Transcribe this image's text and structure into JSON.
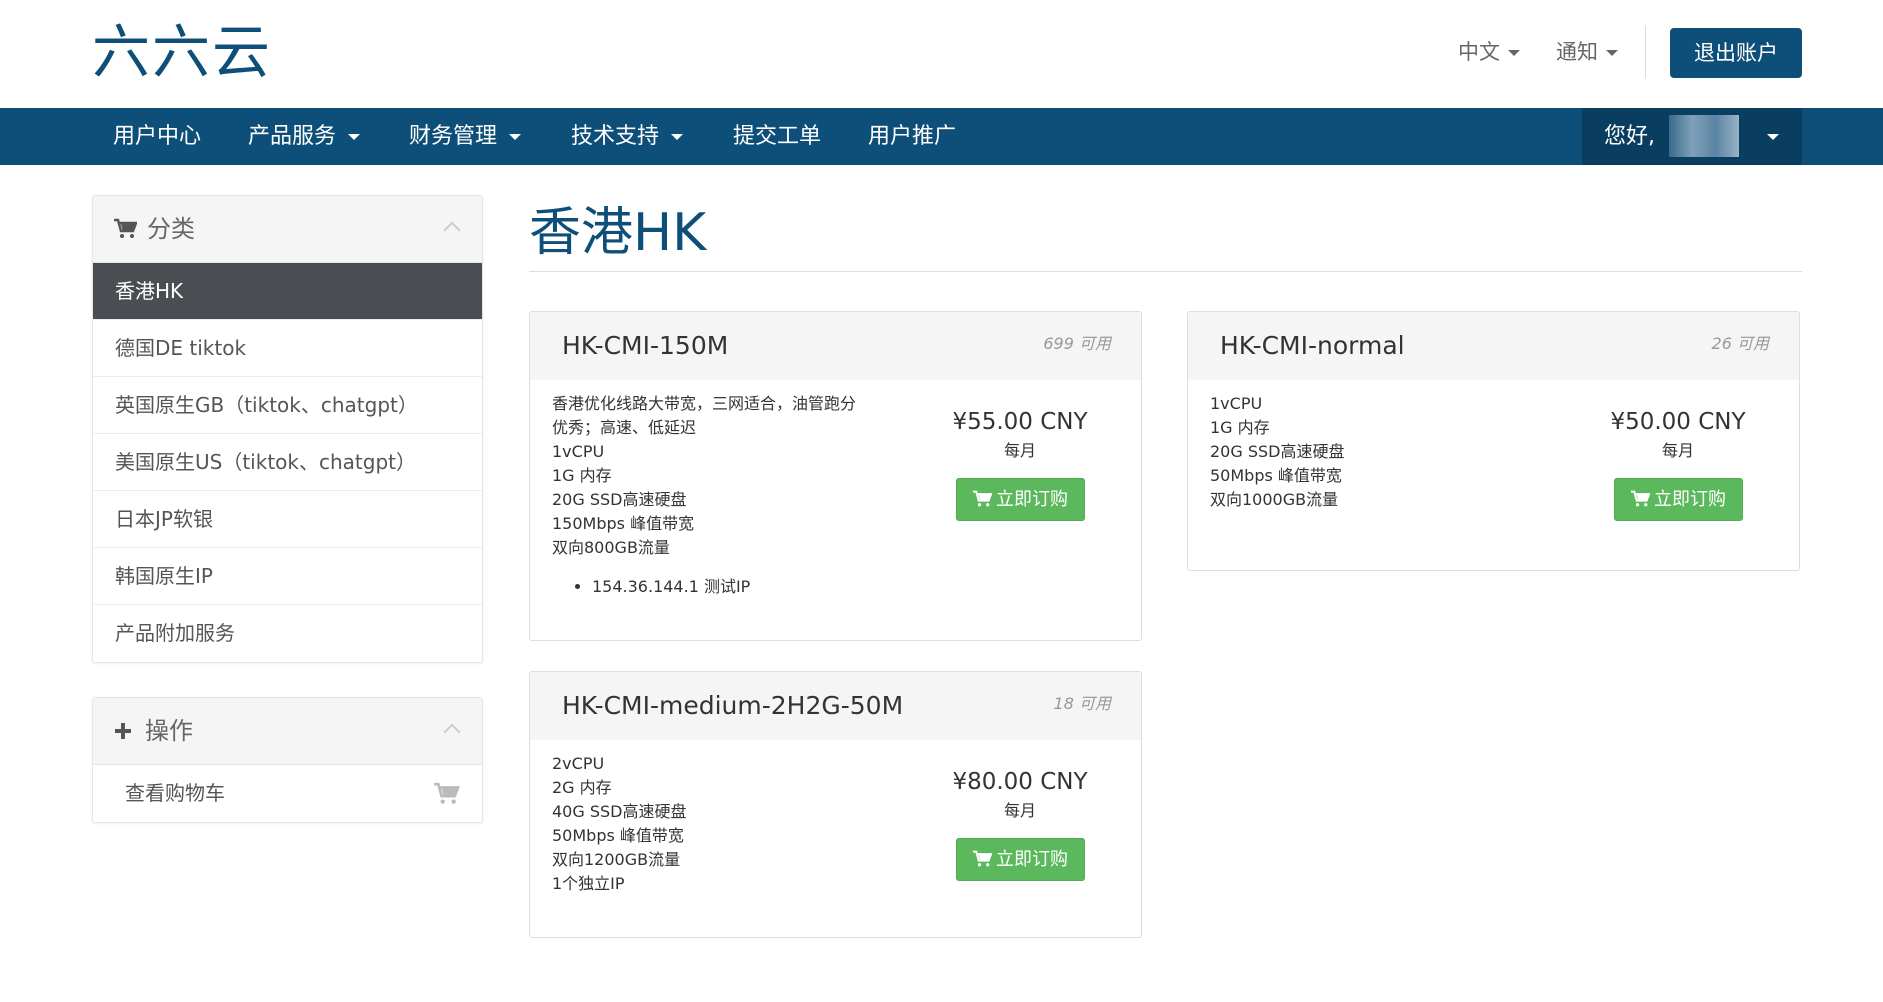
{
  "header": {
    "logo_text": "六六云",
    "language_label": "中文",
    "notifications_label": "通知",
    "logout_label": "退出账户"
  },
  "nav": {
    "items": [
      {
        "label": "用户中心",
        "dropdown": false
      },
      {
        "label": "产品服务",
        "dropdown": true
      },
      {
        "label": "财务管理",
        "dropdown": true
      },
      {
        "label": "技术支持",
        "dropdown": true
      },
      {
        "label": "提交工单",
        "dropdown": false
      },
      {
        "label": "用户推广",
        "dropdown": false
      }
    ],
    "greeting": "您好,"
  },
  "sidebar": {
    "categories_title": "分类",
    "categories": [
      {
        "label": "香港HK",
        "active": true
      },
      {
        "label": "德国DE tiktok",
        "active": false
      },
      {
        "label": "英国原生GB（tiktok、chatgpt）",
        "active": false
      },
      {
        "label": "美国原生US（tiktok、chatgpt）",
        "active": false
      },
      {
        "label": "日本JP软银",
        "active": false
      },
      {
        "label": "韩国原生IP",
        "active": false
      },
      {
        "label": "产品附加服务",
        "active": false
      }
    ],
    "actions_title": "操作",
    "actions": [
      {
        "label": "查看购物车"
      }
    ]
  },
  "main": {
    "page_title": "香港HK",
    "products": [
      {
        "name": "HK-CMI-150M",
        "availability": "699 可用",
        "description": [
          "香港优化线路大带宽，三网适合，油管跑分",
          "优秀；高速、低延迟",
          "1vCPU",
          "1G 内存",
          "20G SSD高速硬盘",
          "150Mbps 峰值带宽",
          "双向800GB流量"
        ],
        "features": [
          "154.36.144.1 测试IP"
        ],
        "price": "¥55.00 CNY",
        "cycle": "每月",
        "order_label": "立即订购"
      },
      {
        "name": "HK-CMI-normal",
        "availability": "26 可用",
        "description": [
          "1vCPU",
          "1G 内存",
          "20G SSD高速硬盘",
          "50Mbps 峰值带宽",
          "双向1000GB流量"
        ],
        "features": [],
        "price": "¥50.00 CNY",
        "cycle": "每月",
        "order_label": "立即订购"
      },
      {
        "name": "HK-CMI-medium-2H2G-50M",
        "availability": "18 可用",
        "description": [
          "2vCPU",
          "2G 内存",
          "40G SSD高速硬盘",
          "50Mbps 峰值带宽",
          "双向1200GB流量",
          "1个独立IP"
        ],
        "features": [],
        "price": "¥80.00 CNY",
        "cycle": "每月",
        "order_label": "立即订购"
      }
    ]
  },
  "colors": {
    "brand": "#0e4f79",
    "order_button": "#5cb85c",
    "active_category": "#4a4e52"
  }
}
